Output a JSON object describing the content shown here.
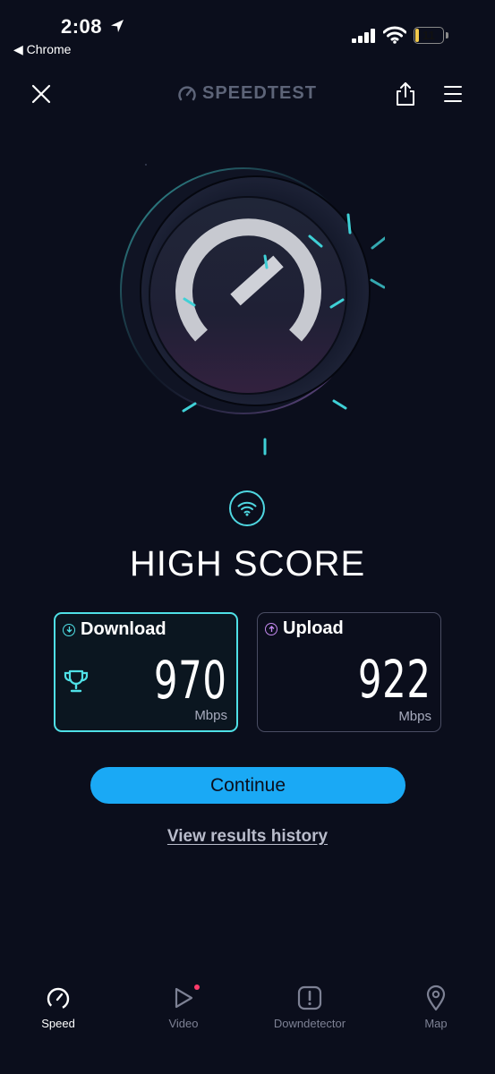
{
  "status_bar": {
    "time": "2:08",
    "back_app": "◀ Chrome",
    "battery": "11",
    "battery_percent": 11
  },
  "header": {
    "logo_text": "SPEEDTEST"
  },
  "result": {
    "headline": "HIGH SCORE",
    "download": {
      "label": "Download",
      "value": "970",
      "unit": "Mbps"
    },
    "upload": {
      "label": "Upload",
      "value": "922",
      "unit": "Mbps"
    }
  },
  "actions": {
    "continue_label": "Continue",
    "history_label": "View results history"
  },
  "tabs": [
    {
      "label": "Speed",
      "icon": "gauge-icon",
      "active": true
    },
    {
      "label": "Video",
      "icon": "play-icon",
      "active": false
    },
    {
      "label": "Downdetector",
      "icon": "alert-icon",
      "active": false
    },
    {
      "label": "Map",
      "icon": "map-pin-icon",
      "active": false
    }
  ],
  "colors": {
    "background": "#0b0e1c",
    "accent_cyan": "#4fe0e6",
    "continue_blue": "#1aa9f5",
    "upload_purple": "#c58af0",
    "notification_dot": "#ff3b6b"
  }
}
